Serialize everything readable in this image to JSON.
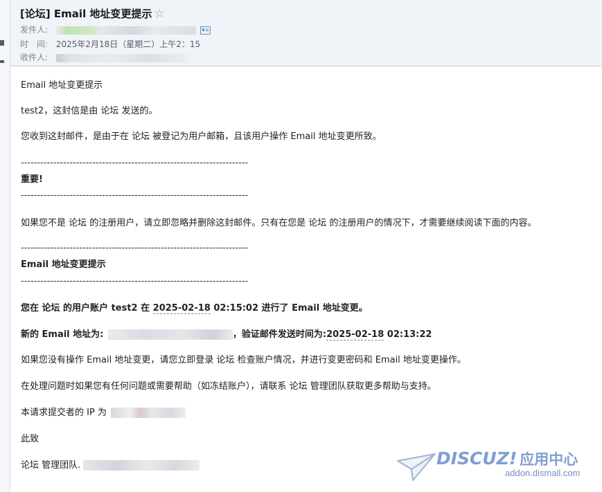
{
  "header": {
    "subject": "[论坛] Email 地址变更提示",
    "star_glyph": "☆",
    "from_label": "发件人:",
    "time_label": "时　间:",
    "time_value": "2025年2月18日（星期二）上午2：15",
    "to_label": "收件人:"
  },
  "body": {
    "line1": "Email 地址变更提示",
    "line2": "test2，这封信是由 论坛 发送的。",
    "line3": "您收到这封邮件，是由于在 论坛 被登记为用户邮箱，且该用户操作 Email 地址变更所致。",
    "divider": "----------------------------------------------------------------------",
    "important": "重要!",
    "notice": "如果您不是 论坛 的注册用户，请立即忽略并删除这封邮件。只有在您是 论坛 的注册用户的情况下，才需要继续阅读下面的内容。",
    "section_title": "Email 地址变更提示",
    "change_prefix": "您在 论坛 的用户账户 test2 在 ",
    "change_date": "2025-02-18",
    "change_time": " 02:15:02",
    "change_suffix": " 进行了 Email 地址变更。",
    "new_email_label": "新的 Email 地址为:",
    "verify_label": "，验证邮件发送时间为:",
    "verify_date": "2025-02-18",
    "verify_time": " 02:13:22",
    "advice": "如果您没有操作 Email 地址变更，请您立即登录 论坛 检查账户情况，并进行变更密码和 Email 地址变更操作。",
    "help": "在处理问题时如果您有任何问题或需要帮助（如冻结账户），请联系 论坛 管理团队获取更多帮助与支持。",
    "ip_label": "本请求提交者的 IP 为",
    "closing": "此致",
    "signature": "论坛 管理团队."
  },
  "watermark": {
    "brand": "DISCUZ!",
    "brand_cn": "应用中心",
    "url": "addon.dismall.com"
  },
  "colors": {
    "header_bg": "#f0f3f7",
    "brand": "#7e9fd1"
  }
}
